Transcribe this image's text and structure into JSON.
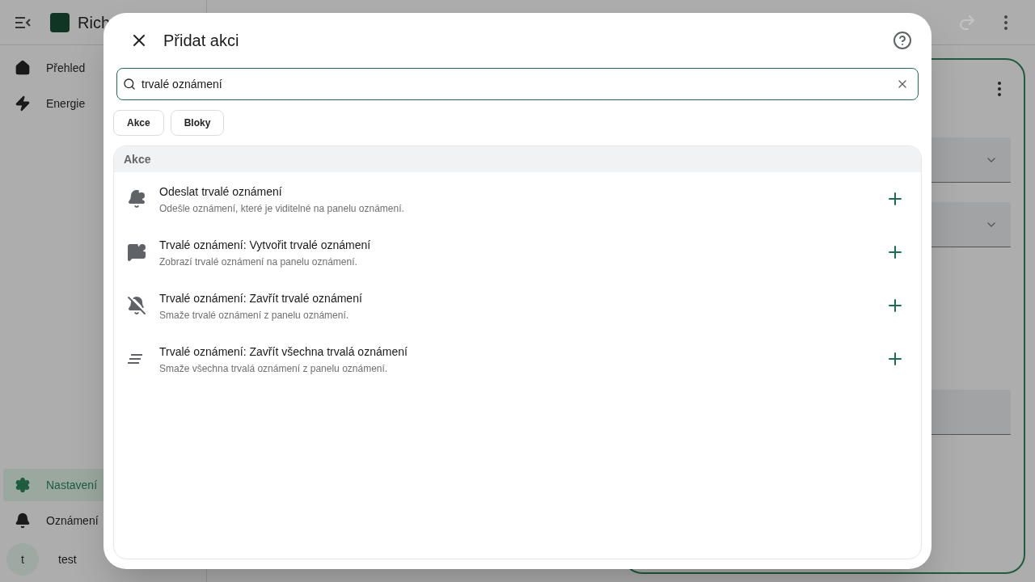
{
  "sidebar": {
    "brand": "Rich",
    "items": [
      {
        "label": "Přehled",
        "selected": false
      },
      {
        "label": "Energie",
        "selected": false
      }
    ],
    "bottom_items": [
      {
        "label": "Nastavení",
        "selected": true
      },
      {
        "label": "Oznámení",
        "selected": false
      }
    ],
    "user": {
      "initial": "t",
      "name": "test"
    }
  },
  "dialog": {
    "title": "Přidat akci",
    "search": {
      "value": "trvalé oznámení"
    },
    "filters": [
      {
        "label": "Akce",
        "selected": false
      },
      {
        "label": "Bloky",
        "selected": false
      }
    ],
    "section": "Akce",
    "items": [
      {
        "kind": "notify",
        "title": "Odeslat trvalé oznámení",
        "description": "Odešle oznámení, které je viditelné na panelu oznámení."
      },
      {
        "kind": "create",
        "title": "Trvalé oznámení: Vytvořit trvalé oznámení",
        "description": "Zobrazí trvalé oznámení na panelu oznámení."
      },
      {
        "kind": "dismiss",
        "title": "Trvalé oznámení: Zavřít trvalé oznámení",
        "description": "Smaže trvalé oznámení z panelu oznámení."
      },
      {
        "kind": "dismiss_all",
        "title": "Trvalé oznámení: Zavřít všechna trvalá oznámení",
        "description": "Smaže všechna trvalá oznámení z panelu oznámení."
      }
    ]
  }
}
